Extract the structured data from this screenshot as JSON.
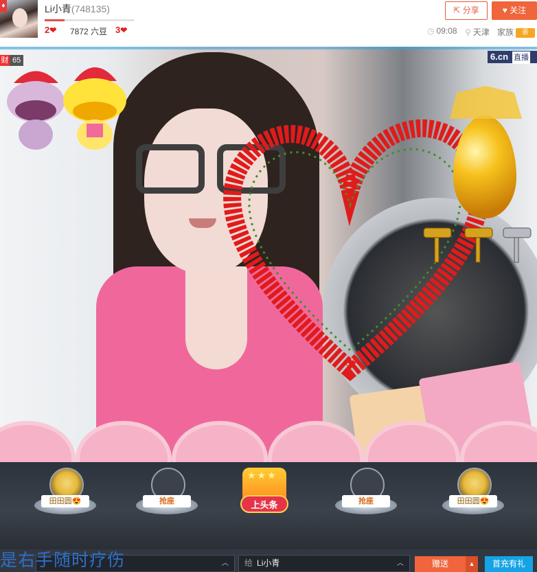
{
  "header": {
    "host_name": "Li小青",
    "host_id": "(748135)",
    "level_left": "2",
    "level_right": "3",
    "beans": "7872 六豆",
    "level_progress": 0.22,
    "share_label": "分享",
    "follow_label": "关注",
    "time": "09:08",
    "city": "天津",
    "family_label": "家族",
    "family_badge": "亲"
  },
  "video": {
    "brand": "6.cn",
    "live_label": "直播",
    "wealth_icon": "财",
    "wealth_level": "65"
  },
  "seats": [
    {
      "label": "田田圆😍",
      "kind": "occupied"
    },
    {
      "label": "抢座",
      "kind": "empty"
    },
    {
      "label": "上头条",
      "kind": "headline"
    },
    {
      "label": "抢座",
      "kind": "empty"
    },
    {
      "label": "田田圆😍",
      "kind": "occupied"
    }
  ],
  "bottom": {
    "marquee": "是右手随时疗伤",
    "gift_select": "",
    "recipient_prefix": "给",
    "recipient": "Li小青",
    "give_label": "赠送",
    "recharge_label": "首充有礼"
  },
  "colors": {
    "accent": "#f0653b",
    "blue": "#16a3e6",
    "seatbar": "#2b333d"
  }
}
